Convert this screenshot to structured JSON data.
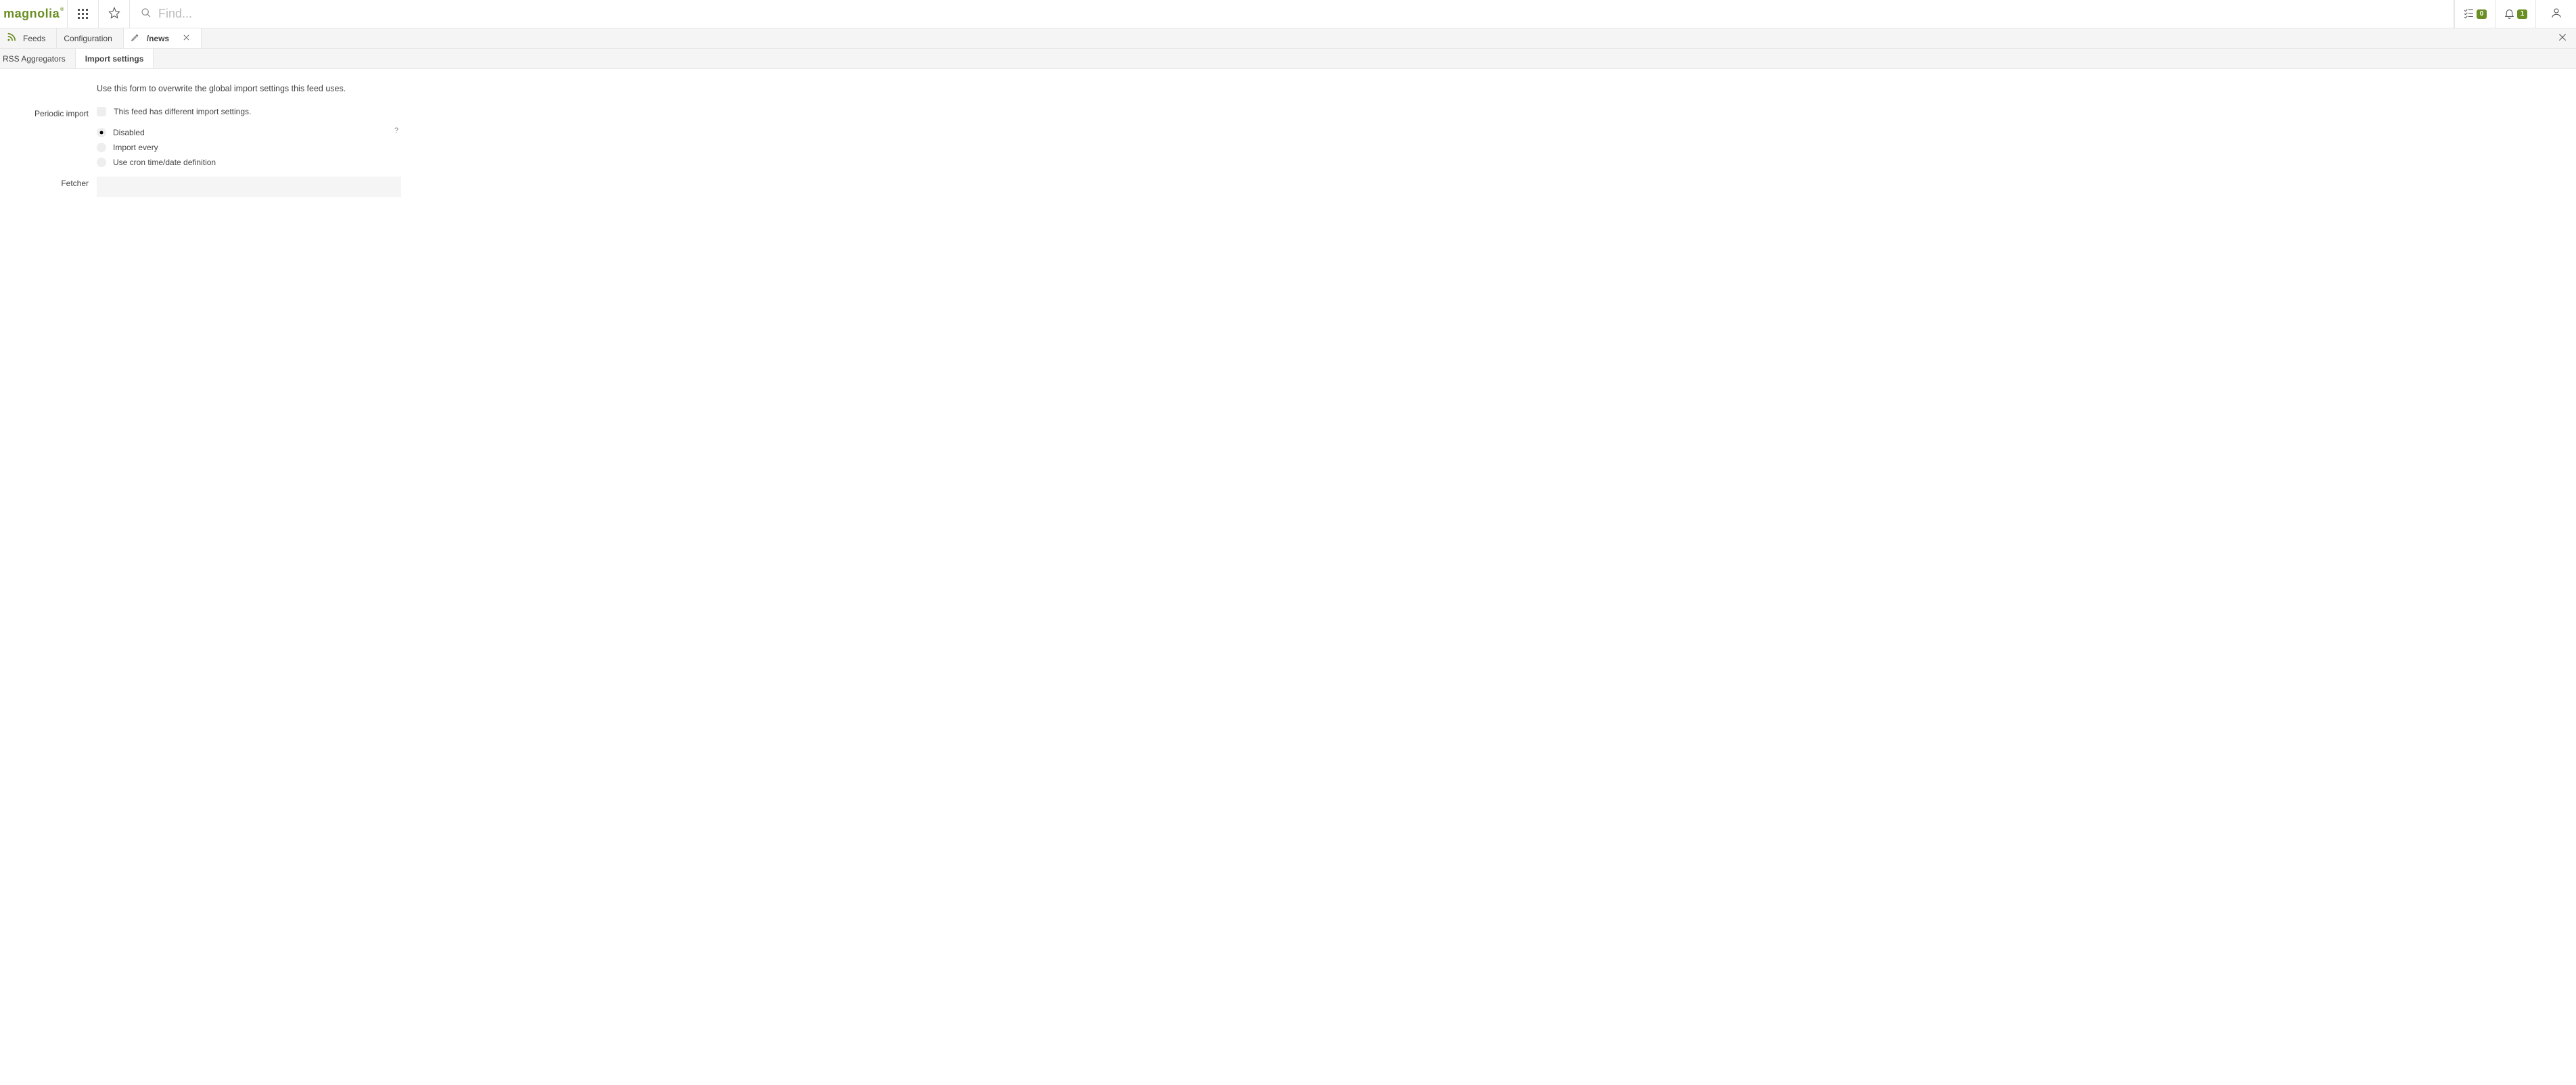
{
  "header": {
    "logo": "magnolia",
    "search_placeholder": "Find...",
    "tasks_badge": "0",
    "notifications_badge": "1"
  },
  "tabs": [
    {
      "label": "Feeds",
      "icon": "rss",
      "active": false,
      "closable": false
    },
    {
      "label": "Configuration",
      "icon": null,
      "active": false,
      "closable": false
    },
    {
      "label": "/news",
      "icon": "pencil",
      "active": true,
      "closable": true
    }
  ],
  "subtabs": [
    {
      "label": "RSS Aggregators",
      "active": false
    },
    {
      "label": "Import settings",
      "active": true
    }
  ],
  "form": {
    "description": "Use this form to overwrite the global import settings this feed uses.",
    "periodic_import_label": "Periodic import",
    "periodic_import_checkbox_label": "This feed has different import settings.",
    "periodic_import_checked": false,
    "radio_options": [
      {
        "label": "Disabled",
        "selected": true
      },
      {
        "label": "Import every",
        "selected": false
      },
      {
        "label": "Use cron time/date definition",
        "selected": false
      }
    ],
    "help_marker": "?",
    "fetcher_label": "Fetcher",
    "fetcher_value": ""
  }
}
